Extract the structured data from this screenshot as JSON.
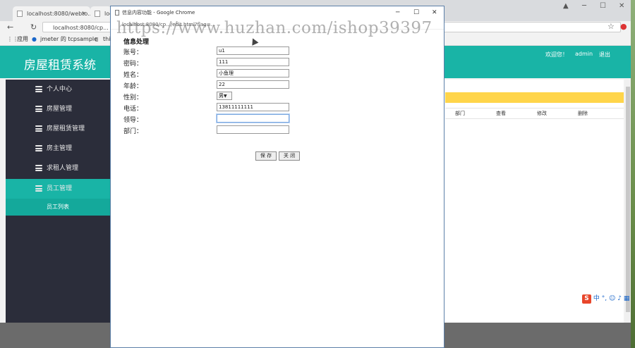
{
  "browser": {
    "tabs": [
      {
        "label": "localhost:8080/webto..."
      },
      {
        "label": "loc"
      }
    ],
    "address": "localhost:8080/cp...",
    "bookmarks": [
      "应用",
      "jmeter 的 tcpsample",
      "thi"
    ]
  },
  "app": {
    "title": "房屋租赁系统",
    "header_links": {
      "welcome": "欢迎您！",
      "user": "admin",
      "logout": "退出"
    }
  },
  "sidebar": {
    "items": [
      {
        "label": "个人中心"
      },
      {
        "label": "房屋管理"
      },
      {
        "label": "房屋租赁管理"
      },
      {
        "label": "房主管理"
      },
      {
        "label": "求租人管理"
      },
      {
        "label": "员工管理"
      }
    ],
    "sub_item": "员工列表"
  },
  "table": {
    "headers": [
      "部门",
      "查看",
      "修改",
      "删除"
    ]
  },
  "popup": {
    "window_title": "信息内容功能 - Google Chrome",
    "url": "localhost:8080/cp.../edit.html?flag=...",
    "form_title": "信息处理",
    "fields": [
      {
        "label": "账号：",
        "value": "u1"
      },
      {
        "label": "密码：",
        "value": "111"
      },
      {
        "label": "姓名：",
        "value": "小鱼理"
      },
      {
        "label": "年龄：",
        "value": "22"
      },
      {
        "label": "性别：",
        "value": "男"
      },
      {
        "label": "电话：",
        "value": "13811111111"
      },
      {
        "label": "领导：",
        "value": ""
      },
      {
        "label": "部门：",
        "value": ""
      }
    ],
    "buttons": {
      "save": "保 存",
      "close": "关 闭"
    }
  },
  "watermark": "https://www.huzhan.com/ishop39397",
  "ime": {
    "label": "中"
  }
}
